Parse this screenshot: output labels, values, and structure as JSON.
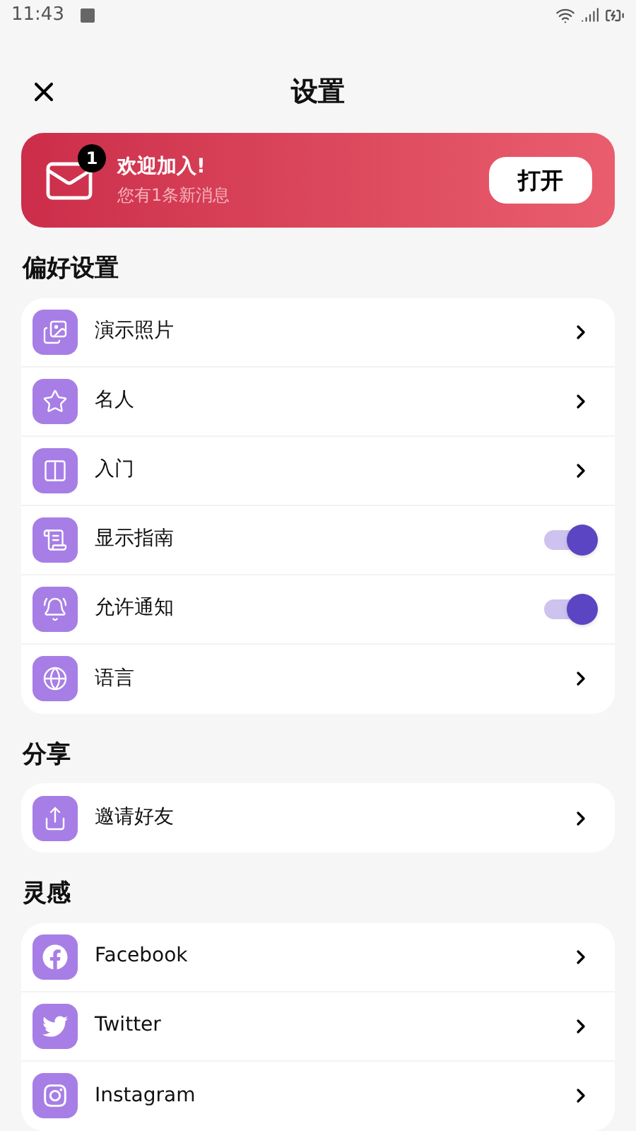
{
  "status_bar": {
    "time": "11:43"
  },
  "header": {
    "title": "设置"
  },
  "banner": {
    "badge": "1",
    "title": "欢迎加入!",
    "subtitle": "您有1条新消息",
    "button": "打开"
  },
  "sections": [
    {
      "title": "偏好设置",
      "items": [
        {
          "label": "演示照片",
          "kind": "link"
        },
        {
          "label": "名人",
          "kind": "link"
        },
        {
          "label": "入门",
          "kind": "link"
        },
        {
          "label": "显示指南",
          "kind": "toggle",
          "on": true
        },
        {
          "label": "允许通知",
          "kind": "toggle",
          "on": true
        },
        {
          "label": "语言",
          "kind": "link"
        }
      ]
    },
    {
      "title": "分享",
      "items": [
        {
          "label": "邀请好友",
          "kind": "link"
        }
      ]
    },
    {
      "title": "灵感",
      "items": [
        {
          "label": "Facebook",
          "kind": "link"
        },
        {
          "label": "Twitter",
          "kind": "link"
        },
        {
          "label": "Instagram",
          "kind": "link"
        }
      ]
    }
  ]
}
